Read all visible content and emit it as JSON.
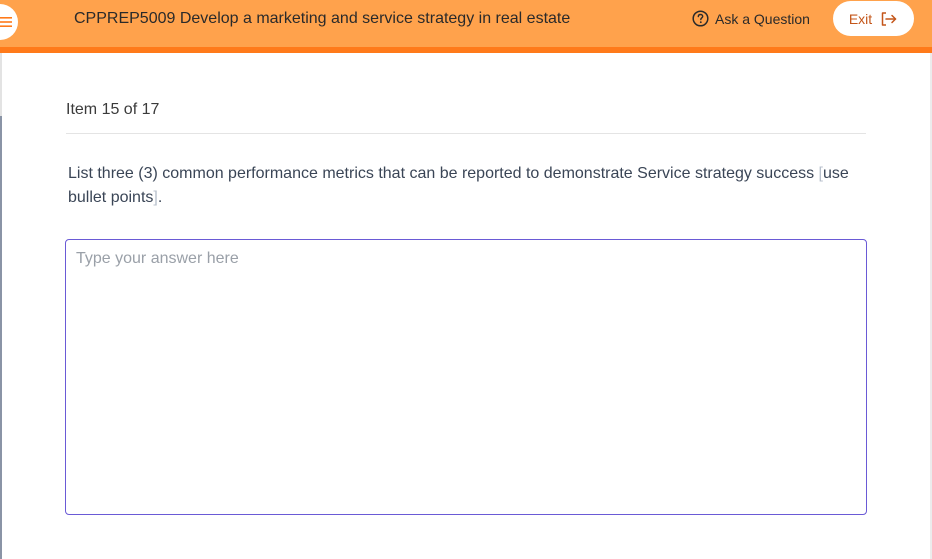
{
  "header": {
    "course_title": "CPPREP5009 Develop a marketing and service strategy in real estate",
    "ask_question_label": "Ask a Question",
    "exit_label": "Exit",
    "colors": {
      "background": "#ffa24c",
      "accent_bar": "#ff7a1a",
      "exit_text": "#c4561a"
    },
    "icons": {
      "menu": "hamburger-menu-icon",
      "ask": "question-circle-icon",
      "exit": "logout-arrow-icon"
    }
  },
  "content": {
    "item_counter": "Item 15 of 17",
    "question_main": "List three (3) common performance metrics that can be reported to demonstrate Service strategy success ",
    "question_bracket_open": "[",
    "question_inner": "use bullet points",
    "question_bracket_close": "]",
    "question_end": ".",
    "answer": {
      "value": "",
      "placeholder": "Type your answer here",
      "border_color": "#6a5ad6"
    }
  }
}
